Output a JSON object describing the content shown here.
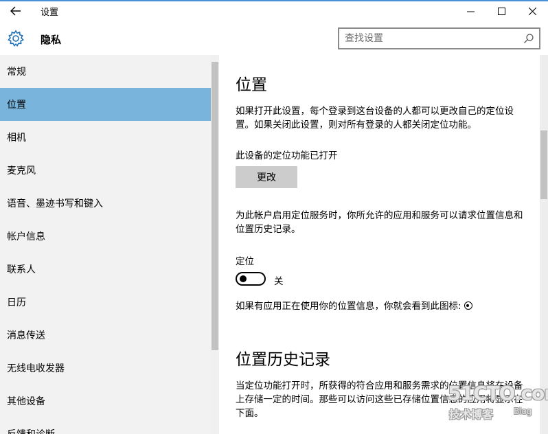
{
  "window": {
    "title": "设置",
    "accent": "#4a90d9"
  },
  "header": {
    "section_title": "隐私",
    "search_placeholder": "查找设置"
  },
  "sidebar": {
    "selected_color": "#79b4dc",
    "items": [
      {
        "label": "常规"
      },
      {
        "label": "位置"
      },
      {
        "label": "相机"
      },
      {
        "label": "麦克风"
      },
      {
        "label": "语音、墨迹书写和键入"
      },
      {
        "label": "帐户信息"
      },
      {
        "label": "联系人"
      },
      {
        "label": "日历"
      },
      {
        "label": "消息传送"
      },
      {
        "label": "无线电收发器"
      },
      {
        "label": "其他设备"
      },
      {
        "label": "反馈和诊断"
      }
    ],
    "selected_index": 1
  },
  "main": {
    "heading": "位置",
    "intro": "如果打开此设置，每个登录到这台设备的人都可以更改自己的定位设置。如果关闭此设置，则对所有登录的人都关闭定位功能。",
    "device_status": "此设备的定位功能已打开",
    "change_button": "更改",
    "account_desc": "为此帐户启用定位服务时，你所允许的应用和服务可以请求位置信息和位置历史记录。",
    "location_label": "定位",
    "toggle_state": "关",
    "toggle_on": false,
    "icon_hint": "如果有应用正在使用你的位置信息，你就会看到此图标:",
    "history_heading": "位置历史记录",
    "history_desc": "当定位功能打开时，所获得的符合应用和服务需求的位置信息将在设备上存储一定的时间。那些可以访问这些已存储位置信息的应用将显示在下面。"
  },
  "watermark": {
    "main": "51CTO.com",
    "sub": "技术博客",
    "blog": "Blog"
  }
}
